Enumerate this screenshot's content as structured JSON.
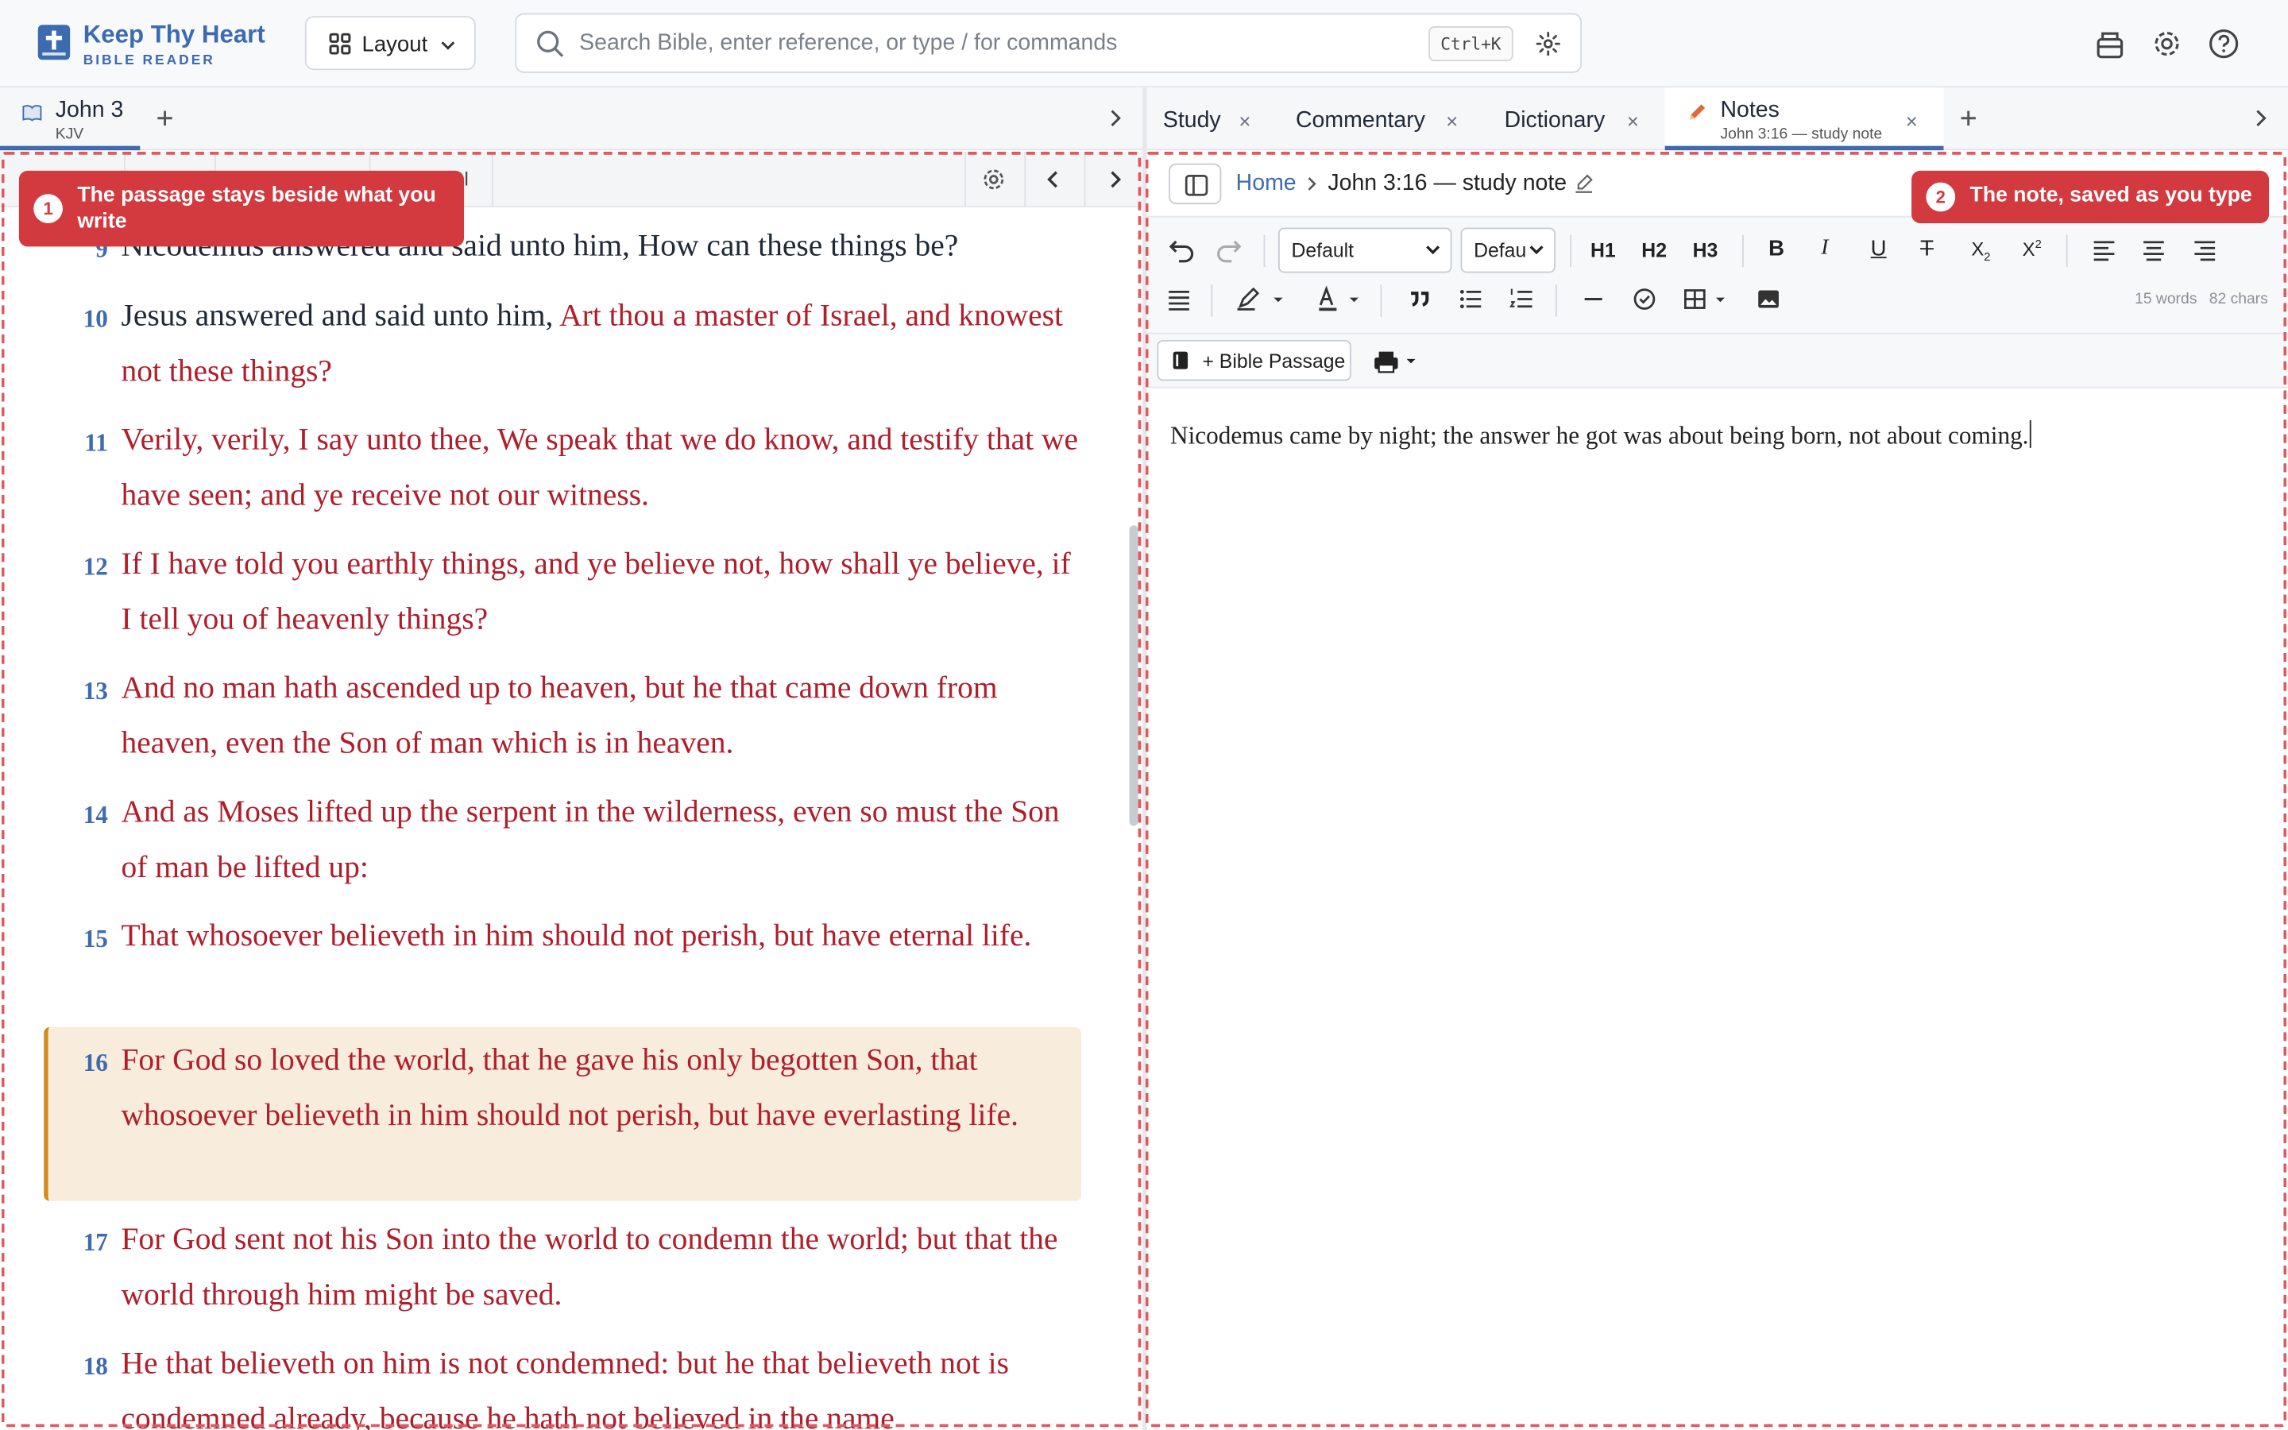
{
  "app": {
    "brand_title": "Keep Thy Heart",
    "brand_subtitle": "BIBLE READER",
    "layout_label": "Layout",
    "search_placeholder": "Search Bible, enter reference, or type / for commands",
    "search_shortcut": "Ctrl+K"
  },
  "left_tabs": [
    {
      "title": "John 3",
      "subtitle": "KJV",
      "active": true
    }
  ],
  "right_tabs": [
    {
      "title": "Study",
      "active": false
    },
    {
      "title": "Commentary",
      "active": false
    },
    {
      "title": "Dictionary",
      "active": false
    },
    {
      "title": "Notes",
      "subtitle": "John 3:16 — study note",
      "active": true
    }
  ],
  "left_toolbar": {
    "partial_label": "el"
  },
  "verses": [
    {
      "num": "9",
      "text_black": "Nicodemus answered and said unto him, How can these things be?",
      "text_red": ""
    },
    {
      "num": "10",
      "text_black": "Jesus answered and said unto him, ",
      "text_red": "Art thou a master of Israel, and knowest not these things?"
    },
    {
      "num": "11",
      "text_black": "",
      "text_red": "Verily, verily, I say unto thee, We speak that we do know, and testify that we have seen; and ye receive not our witness."
    },
    {
      "num": "12",
      "text_black": "",
      "text_red": "If I have told you earthly things, and ye believe not, how shall ye believe, if I tell you of heavenly things?"
    },
    {
      "num": "13",
      "text_black": "",
      "text_red": "And no man hath ascended up to heaven, but he that came down from heaven, even the Son of man which is in heaven."
    },
    {
      "num": "14",
      "text_black": "",
      "text_red": "And as Moses lifted up the serpent in the wilderness, even so must the Son of man be lifted up:"
    },
    {
      "num": "15",
      "text_black": "",
      "text_red": "That whosoever believeth in him should not perish, but have eternal life."
    },
    {
      "num": "16",
      "text_black": "",
      "text_red": "For God so loved the world, that he gave his only begotten Son, that whosoever believeth in him should not perish, but have everlasting life.",
      "highlighted": true
    },
    {
      "num": "17",
      "text_black": "",
      "text_red": "For God sent not his Son into the world to condemn the world; but that the world through him might be saved."
    },
    {
      "num": "18",
      "text_black": "",
      "text_red": "He that believeth on him is not condemned: but he that believeth not is condemned already, because he hath not believed in the name"
    }
  ],
  "callouts": [
    {
      "num": "1",
      "text": "The passage stays beside what you write"
    },
    {
      "num": "2",
      "text": "The note, saved as you type"
    }
  ],
  "notes": {
    "breadcrumb_home": "Home",
    "breadcrumb_current": "John 3:16 — study note",
    "style_select": "Default",
    "font_select": "Defau",
    "h1": "H1",
    "h2": "H2",
    "h3": "H3",
    "word_count": "15 words",
    "char_count": "82 chars",
    "bible_passage_button": "+ Bible Passage",
    "content": "Nicodemus came by night; the answer he got was about being born, not about coming."
  },
  "colors": {
    "brand": "#3d6bb0",
    "words_of_christ": "#b01e2b",
    "highlight_bg": "#f8ecdc",
    "highlight_border": "#d48a1d",
    "callout": "#d23a3f"
  }
}
